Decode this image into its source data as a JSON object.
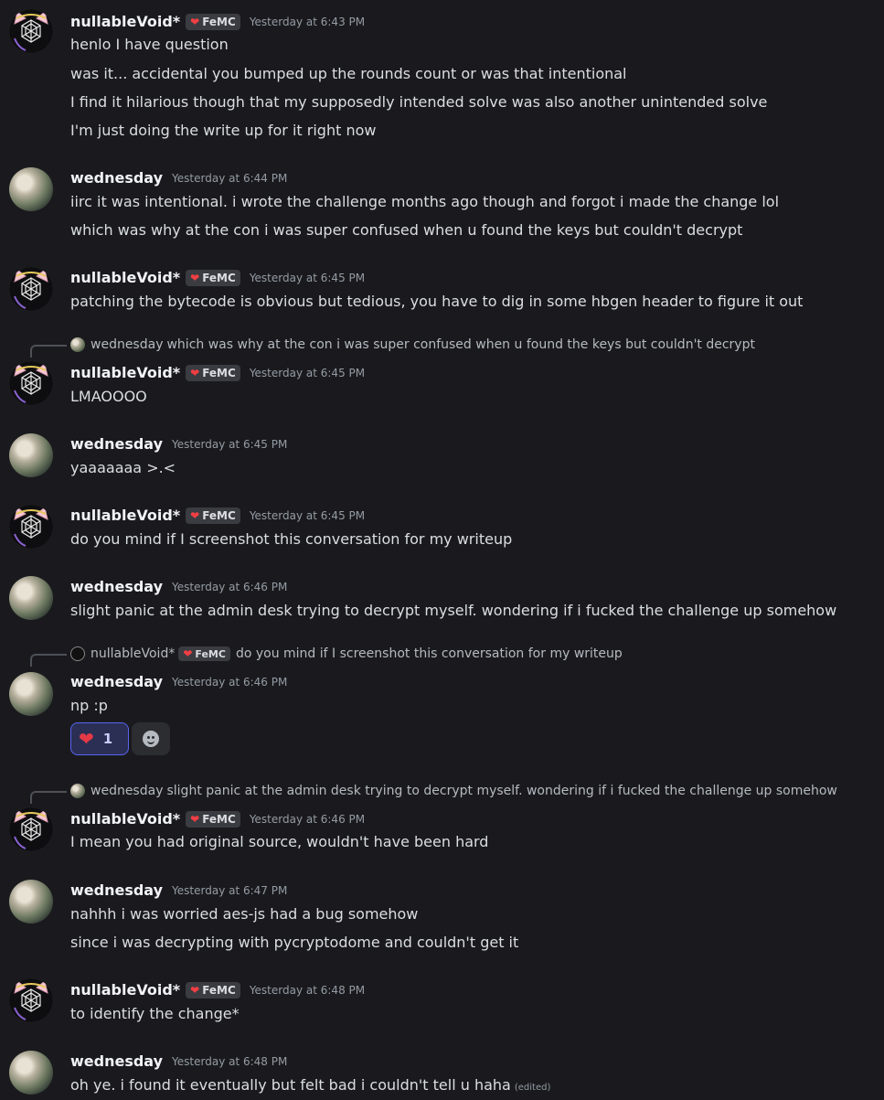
{
  "users": {
    "nullable": {
      "name": "nullableVoid*",
      "tag": "FeMC",
      "avatar_icon": "cat-ear-geometric-avatar"
    },
    "wednesday": {
      "name": "wednesday",
      "avatar_icon": "photo-avatar"
    }
  },
  "messages": [
    {
      "time": "Yesterday at 6:43 PM",
      "lines": [
        "henlo I have question",
        "was it... accidental you bumped up the rounds count or was that intentional",
        "I find it hilarious though that my supposedly intended solve was also another unintended solve",
        "I'm just doing the write up for it right now"
      ]
    },
    {
      "time": "Yesterday at 6:44 PM",
      "lines": [
        "iirc it was intentional. i wrote the challenge months ago though and forgot i made the change lol",
        "which was why at the con i was super confused when u found the keys but couldn't decrypt"
      ]
    },
    {
      "time": "Yesterday at 6:45 PM",
      "lines": [
        "patching the bytecode is obvious but tedious, you have to dig in some hbgen header to figure it out"
      ]
    },
    {
      "reply": {
        "name": "wednesday",
        "text": "which was why at the con i was super confused when u found the keys but couldn't decrypt"
      },
      "time": "Yesterday at 6:45 PM",
      "lines": [
        "LMAOOOO"
      ]
    },
    {
      "time": "Yesterday at 6:45 PM",
      "lines": [
        "yaaaaaaa >.<"
      ]
    },
    {
      "time": "Yesterday at 6:45 PM",
      "lines": [
        "do you mind if I screenshot this conversation for my writeup"
      ]
    },
    {
      "time": "Yesterday at 6:46 PM",
      "lines": [
        "slight panic at the admin desk trying to decrypt myself. wondering if i fucked the challenge up somehow"
      ]
    },
    {
      "reply": {
        "name": "nullableVoid*",
        "tag": "FeMC",
        "text": "do you mind if I screenshot this conversation for my writeup"
      },
      "time": "Yesterday at 6:46 PM",
      "lines": [
        "np :p"
      ],
      "reaction": {
        "icon": "heart-icon",
        "count": "1"
      }
    },
    {
      "reply": {
        "name": "wednesday",
        "text": "slight panic at the admin desk trying to decrypt myself. wondering if i fucked the challenge up somehow"
      },
      "time": "Yesterday at 6:46 PM",
      "lines": [
        "I mean you had original source, wouldn't have been hard"
      ]
    },
    {
      "time": "Yesterday at 6:47 PM",
      "lines": [
        "nahhh i was worried aes-js had a bug somehow",
        "since i was decrypting with pycryptodome and couldn't get it"
      ]
    },
    {
      "time": "Yesterday at 6:48 PM",
      "lines": [
        "to identify the change*"
      ]
    },
    {
      "time": "Yesterday at 6:48 PM",
      "lines": [
        "oh ye. i found it eventually but felt bad i couldn't tell u haha"
      ],
      "edited": "(edited)"
    }
  ]
}
